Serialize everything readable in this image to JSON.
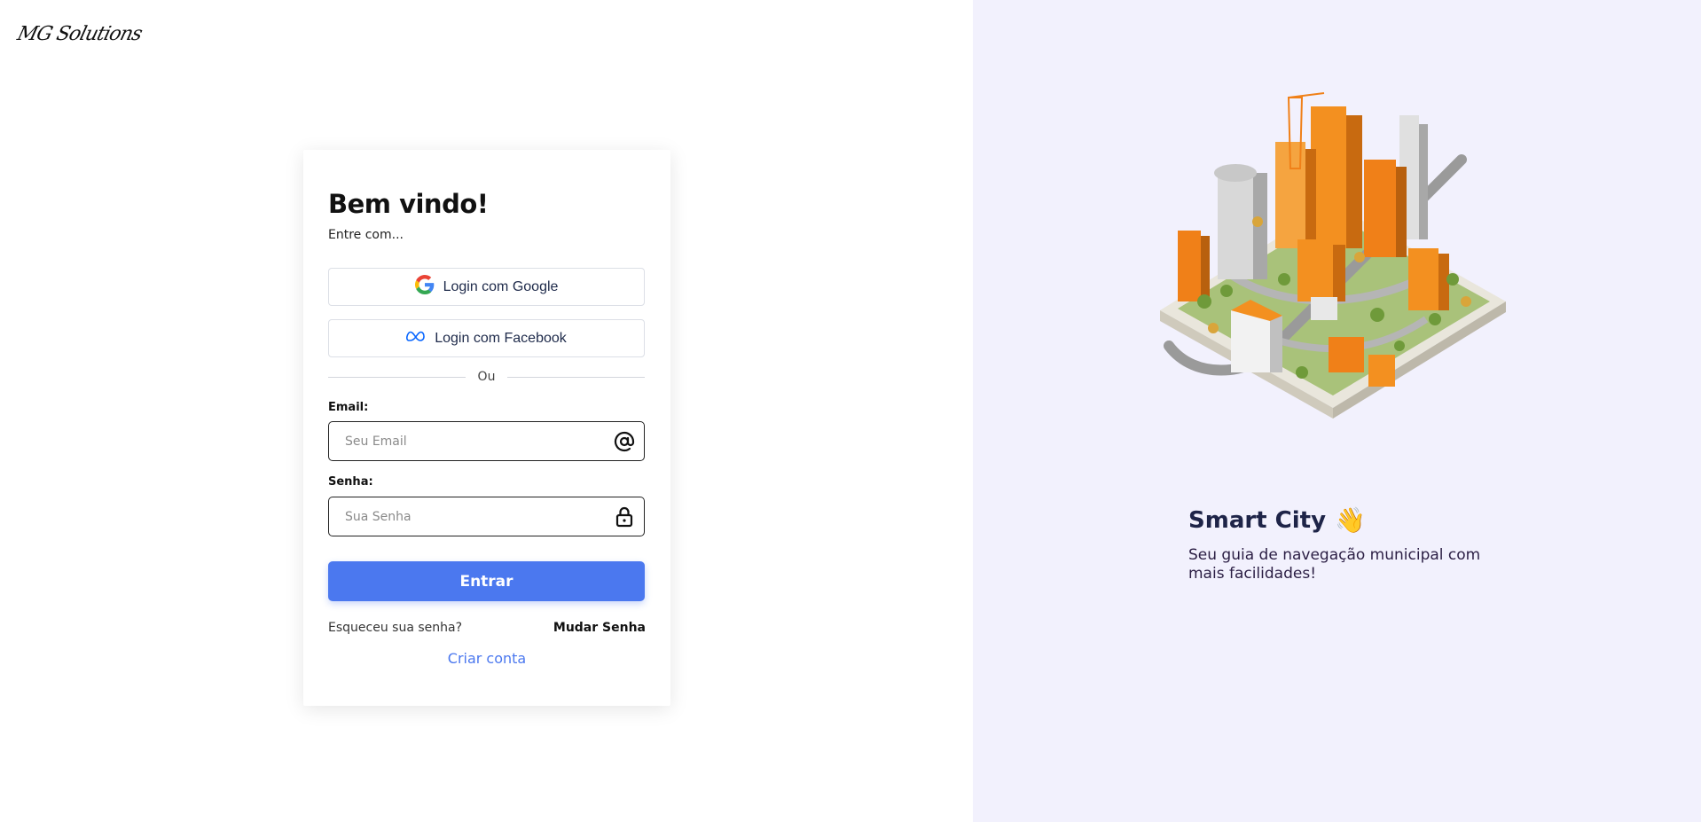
{
  "brand": {
    "logo_text": "MG Solutions"
  },
  "login": {
    "title": "Bem vindo!",
    "subtitle": "Entre com...",
    "google_label": "Login com Google",
    "facebook_label": "Login com Facebook",
    "divider_text": "Ou",
    "email_label": "Email:",
    "email_placeholder": "Seu Email",
    "email_value": "",
    "password_label": "Senha:",
    "password_placeholder": "Sua Senha",
    "password_value": "",
    "submit_label": "Entrar",
    "forgot_text": "Esqueceu sua senha?",
    "change_password_label": "Mudar Senha",
    "create_account_label": "Criar conta"
  },
  "promo": {
    "title": "Smart City",
    "emoji": "👋",
    "subtitle": "Seu guia de navegação municipal com mais facilidades!"
  },
  "colors": {
    "primary": "#4b78ef",
    "right_panel_bg": "#f2f1fd",
    "accent_orange": "#f07a1a"
  },
  "icons": {
    "google": "google-icon",
    "facebook": "meta-icon",
    "email": "at-sign-icon",
    "password": "lock-icon",
    "illustration": "smart-city-illustration"
  }
}
